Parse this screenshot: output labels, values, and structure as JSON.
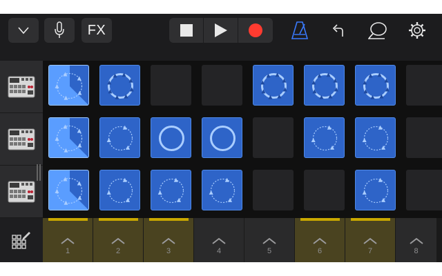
{
  "toolbar": {
    "buttons": [
      {
        "icon": "chevron-down-icon"
      },
      {
        "icon": "microphone-icon"
      },
      {
        "label": "FX"
      },
      {
        "icon": "stop-icon"
      },
      {
        "icon": "play-icon"
      },
      {
        "icon": "record-icon"
      },
      {
        "icon": "metronome-icon"
      },
      {
        "icon": "undo-icon"
      },
      {
        "icon": "lasso-icon"
      },
      {
        "icon": "settings-gear-icon"
      }
    ],
    "record_color": "#ff3b30",
    "metronome_color": "#3a7bff"
  },
  "tracks": [
    {
      "instrument_icon": "drum-machine-icon"
    },
    {
      "instrument_icon": "drum-machine-icon"
    },
    {
      "instrument_icon": "drum-machine-icon"
    }
  ],
  "grid": {
    "rows": [
      [
        "active",
        "loop",
        "empty",
        "empty",
        "loop",
        "loop",
        "loop",
        "empty"
      ],
      [
        "active",
        "loop",
        "loop",
        "loop",
        "empty",
        "loop",
        "loop",
        "empty"
      ],
      [
        "active",
        "loop",
        "loop",
        "loop",
        "empty",
        "empty",
        "loop",
        "empty"
      ]
    ],
    "loop_color": "#2e64c8",
    "active_color": "#4d94ff"
  },
  "columns": [
    {
      "number": "1",
      "lit": true
    },
    {
      "number": "2",
      "lit": true
    },
    {
      "number": "3",
      "lit": true
    },
    {
      "number": "4",
      "lit": false
    },
    {
      "number": "5",
      "lit": false
    },
    {
      "number": "6",
      "lit": true
    },
    {
      "number": "7",
      "lit": true
    },
    {
      "number": "8",
      "lit": false
    }
  ],
  "bottom": {
    "edit_icon": "edit-grid-icon"
  }
}
